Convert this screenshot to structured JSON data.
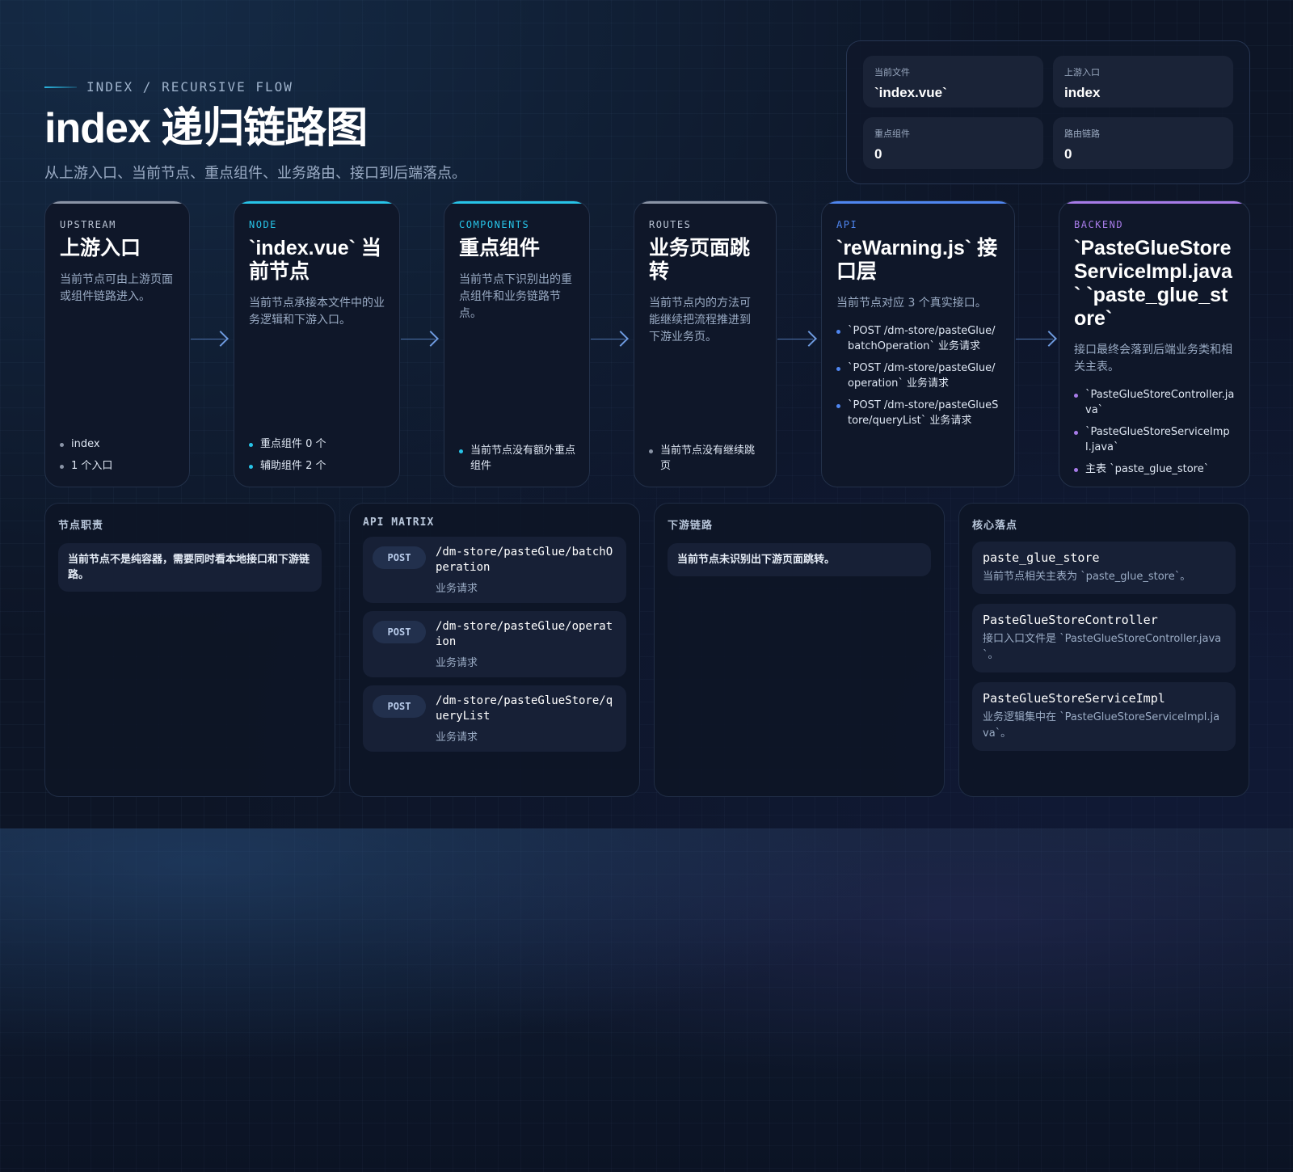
{
  "header": {
    "eyebrow": "INDEX / RECURSIVE FLOW",
    "title": "index 递归链路图",
    "subtitle": "从上游入口、当前节点、重点组件、业务路由、接口到后端落点。"
  },
  "stats": [
    {
      "label": "当前文件",
      "value": "`index.vue`"
    },
    {
      "label": "上游入口",
      "value": "index"
    },
    {
      "label": "重点组件",
      "value": "0"
    },
    {
      "label": "路由链路",
      "value": "0"
    }
  ],
  "flow": {
    "upstream": {
      "kicker": "UPSTREAM",
      "title": "上游入口",
      "desc": "当前节点可由上游页面或组件链路进入。",
      "items": [
        "index",
        "1 个入口"
      ]
    },
    "node": {
      "kicker": "NODE",
      "title": "`index.vue` 当前节点",
      "desc": "当前节点承接本文件中的业务逻辑和下游入口。",
      "items": [
        "重点组件 0 个",
        "辅助组件 2 个"
      ]
    },
    "components": {
      "kicker": "COMPONENTS",
      "title": "重点组件",
      "desc": "当前节点下识别出的重点组件和业务链路节点。",
      "items": [
        "当前节点没有额外重点组件"
      ]
    },
    "routes": {
      "kicker": "ROUTES",
      "title": "业务页面跳转",
      "desc": "当前节点内的方法可能继续把流程推进到下游业务页。",
      "items": [
        "当前节点没有继续跳页"
      ]
    },
    "api": {
      "kicker": "API",
      "title": "`reWarning.js` 接口层",
      "desc": "当前节点对应 3 个真实接口。",
      "items": [
        "`POST /dm-store/pasteGlue/batchOperation` 业务请求",
        "`POST /dm-store/pasteGlue/operation` 业务请求",
        "`POST /dm-store/pasteGlueStore/queryList` 业务请求"
      ]
    },
    "backend": {
      "kicker": "BACKEND",
      "title": "`PasteGlueStoreServiceImpl.java` `paste_glue_store`",
      "desc": "接口最终会落到后端业务类和相关主表。",
      "items": [
        "`PasteGlueStoreController.java`",
        "`PasteGlueStoreServiceImpl.java`",
        "主表 `paste_glue_store`"
      ]
    }
  },
  "panels": {
    "duty": {
      "title": "节点职责",
      "note": "当前节点不是纯容器，需要同时看本地接口和下游链路。"
    },
    "api_matrix": {
      "title": "API MATRIX",
      "items": [
        {
          "method": "POST",
          "path": "/dm-store/pasteGlue/batchOperation",
          "desc": "业务请求"
        },
        {
          "method": "POST",
          "path": "/dm-store/pasteGlue/operation",
          "desc": "业务请求"
        },
        {
          "method": "POST",
          "path": "/dm-store/pasteGlueStore/queryList",
          "desc": "业务请求"
        }
      ]
    },
    "downstream": {
      "title": "下游链路",
      "note": "当前节点未识别出下游页面跳转。"
    },
    "core": {
      "title": "核心落点",
      "items": [
        {
          "name": "paste_glue_store",
          "desc": "当前节点相关主表为 `paste_glue_store`。"
        },
        {
          "name": "PasteGlueStoreController",
          "desc": "接口入口文件是 `PasteGlueStoreController.java`。"
        },
        {
          "name": "PasteGlueStoreServiceImpl",
          "desc": "业务逻辑集中在 `PasteGlueStoreServiceImpl.java`。"
        }
      ]
    }
  },
  "colors": {
    "upstream": "#8a94a6",
    "node": "#27c4e8",
    "components": "#27c4e8",
    "routes": "#8a94a6",
    "api": "#4f86f0",
    "backend": "#a77be8"
  }
}
